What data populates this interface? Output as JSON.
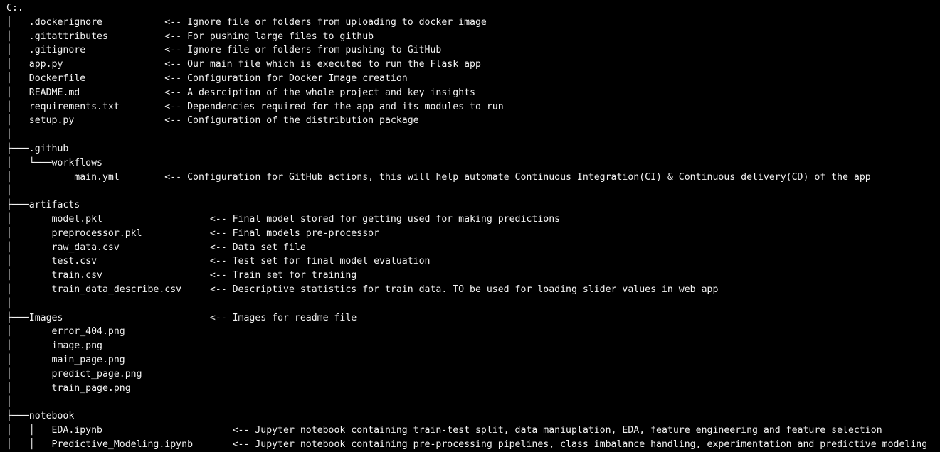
{
  "terminal": {
    "lines": [
      "C:.",
      "│   .dockerignore           <-- Ignore file or folders from uploading to docker image",
      "│   .gitattributes          <-- For pushing large files to github",
      "│   .gitignore              <-- Ignore file or folders from pushing to GitHub",
      "│   app.py                  <-- Our main file which is executed to run the Flask app",
      "│   Dockerfile              <-- Configuration for Docker Image creation",
      "│   README.md               <-- A desrciption of the whole project and key insights",
      "│   requirements.txt        <-- Dependencies required for the app and its modules to run",
      "│   setup.py                <-- Configuration of the distribution package",
      "│",
      "├───.github",
      "│   └───workflows",
      "│           main.yml        <-- Configuration for GitHub actions, this will help automate Continuous Integration(CI) & Continuous delivery(CD) of the app",
      "│",
      "├───artifacts",
      "│       model.pkl                   <-- Final model stored for getting used for making predictions",
      "│       preprocessor.pkl            <-- Final models pre-processor",
      "│       raw_data.csv                <-- Data set file",
      "│       test.csv                    <-- Test set for final model evaluation",
      "│       train.csv                   <-- Train set for training",
      "│       train_data_describe.csv     <-- Descriptive statistics for train data. TO be used for loading slider values in web app",
      "│",
      "├───Images                          <-- Images for readme file",
      "│       error_404.png",
      "│       image.png",
      "│       main_page.png",
      "│       predict_page.png",
      "│       train_page.png",
      "│",
      "├───notebook",
      "│   │   EDA.ipynb                       <-- Jupyter notebook containing train-test split, data maniuplation, EDA, feature engineering and feature selection",
      "│   │   Predictive_Modeling.ipynb       <-- Jupyter notebook containing pre-processing pipelines, class imbalance handling, experimentation and predictive modeling"
    ]
  }
}
